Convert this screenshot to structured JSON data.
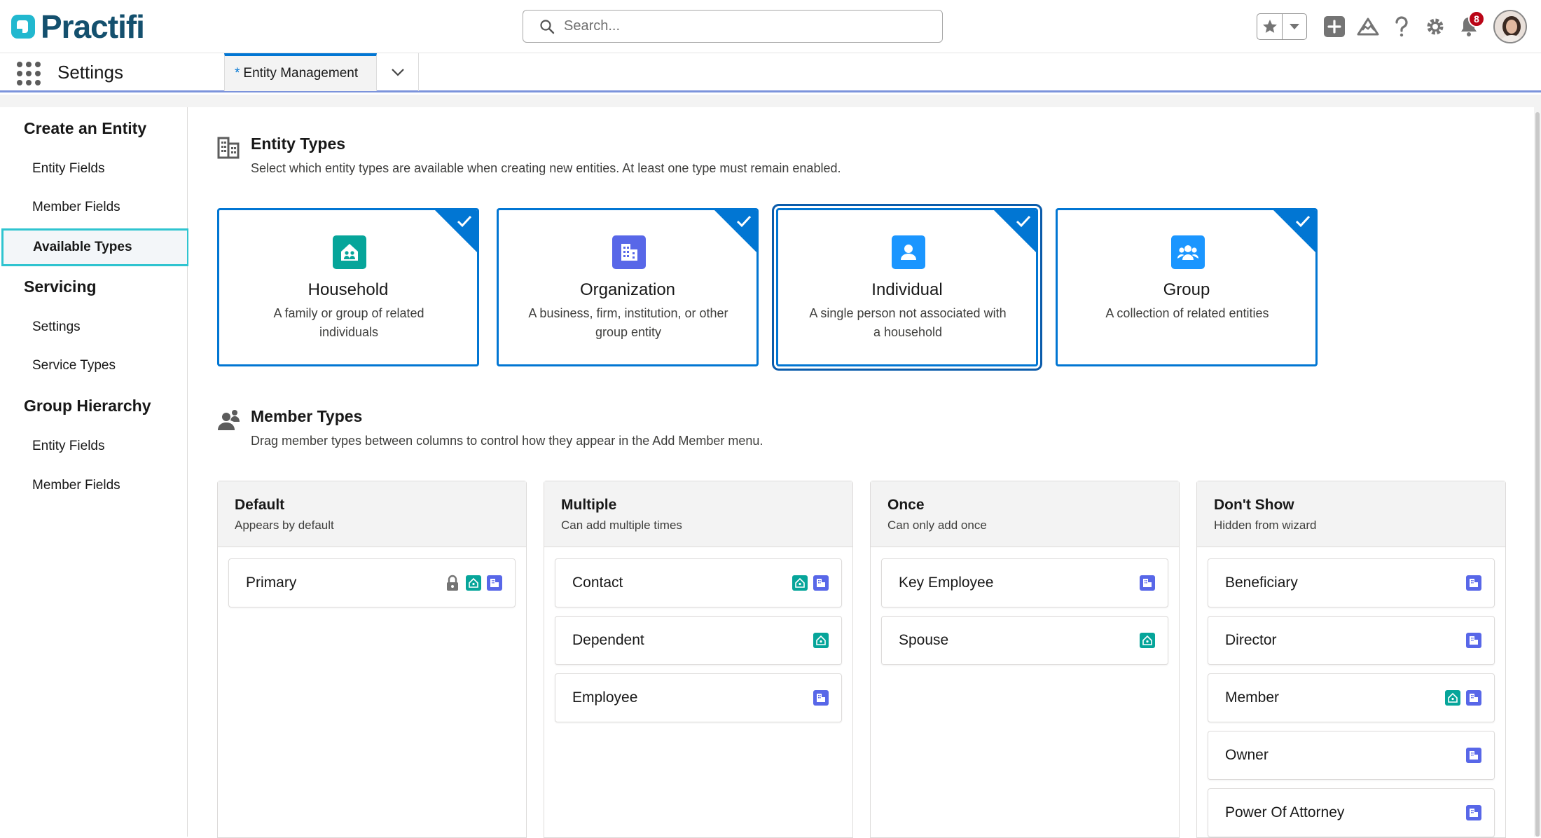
{
  "header": {
    "logo_text": "Practifi",
    "search_placeholder": "Search...",
    "notification_count": "8"
  },
  "nav": {
    "app_name": "Settings",
    "tab": {
      "dirty_marker": "*",
      "label": "Entity Management"
    }
  },
  "sidebar": {
    "sections": [
      {
        "title": "Create an Entity",
        "items": [
          "Entity Fields",
          "Member Fields",
          "Available Types"
        ]
      },
      {
        "title": "Servicing",
        "items": [
          "Settings",
          "Service Types"
        ]
      },
      {
        "title": "Group Hierarchy",
        "items": [
          "Entity Fields",
          "Member Fields"
        ]
      }
    ],
    "active_item": "Available Types"
  },
  "entity_types": {
    "title": "Entity Types",
    "description": "Select which entity types are available when creating new entities. At least one type must remain enabled.",
    "cards": [
      {
        "title": "Household",
        "desc": "A family or group of related individuals",
        "selected": true,
        "icon": "household-icon",
        "color": "#06a59a"
      },
      {
        "title": "Organization",
        "desc": "A business, firm, institution, or other group entity",
        "selected": true,
        "icon": "organization-icon",
        "color": "#5867e8"
      },
      {
        "title": "Individual",
        "desc": "A single person not associated with a household",
        "selected": true,
        "icon": "person-icon",
        "color": "#1b96ff"
      },
      {
        "title": "Group",
        "desc": "A collection of related entities",
        "selected": true,
        "icon": "group-icon",
        "color": "#1b96ff"
      }
    ]
  },
  "member_types": {
    "title": "Member Types",
    "description": "Drag member types between columns to control how they appear in the Add Member menu.",
    "columns": [
      {
        "title": "Default",
        "subtitle": "Appears by default",
        "items": [
          {
            "label": "Primary",
            "locked": true,
            "icons": [
              "household",
              "organization"
            ]
          }
        ]
      },
      {
        "title": "Multiple",
        "subtitle": "Can add multiple times",
        "items": [
          {
            "label": "Contact",
            "icons": [
              "household",
              "organization"
            ]
          },
          {
            "label": "Dependent",
            "icons": [
              "household"
            ]
          },
          {
            "label": "Employee",
            "icons": [
              "organization"
            ]
          }
        ]
      },
      {
        "title": "Once",
        "subtitle": "Can only add once",
        "items": [
          {
            "label": "Key Employee",
            "icons": [
              "organization"
            ]
          },
          {
            "label": "Spouse",
            "icons": [
              "household"
            ]
          }
        ]
      },
      {
        "title": "Don't Show",
        "subtitle": "Hidden from wizard",
        "items": [
          {
            "label": "Beneficiary",
            "icons": [
              "organization"
            ]
          },
          {
            "label": "Director",
            "icons": [
              "organization"
            ]
          },
          {
            "label": "Member",
            "icons": [
              "household",
              "organization"
            ]
          },
          {
            "label": "Owner",
            "icons": [
              "organization"
            ]
          },
          {
            "label": "Power Of Attorney",
            "icons": [
              "organization"
            ]
          }
        ]
      }
    ]
  },
  "colors": {
    "brand": "#14506e",
    "accent": "#0176d3",
    "household": "#06a59a",
    "organization": "#5867e8",
    "highlight": "#2fc4d0"
  }
}
